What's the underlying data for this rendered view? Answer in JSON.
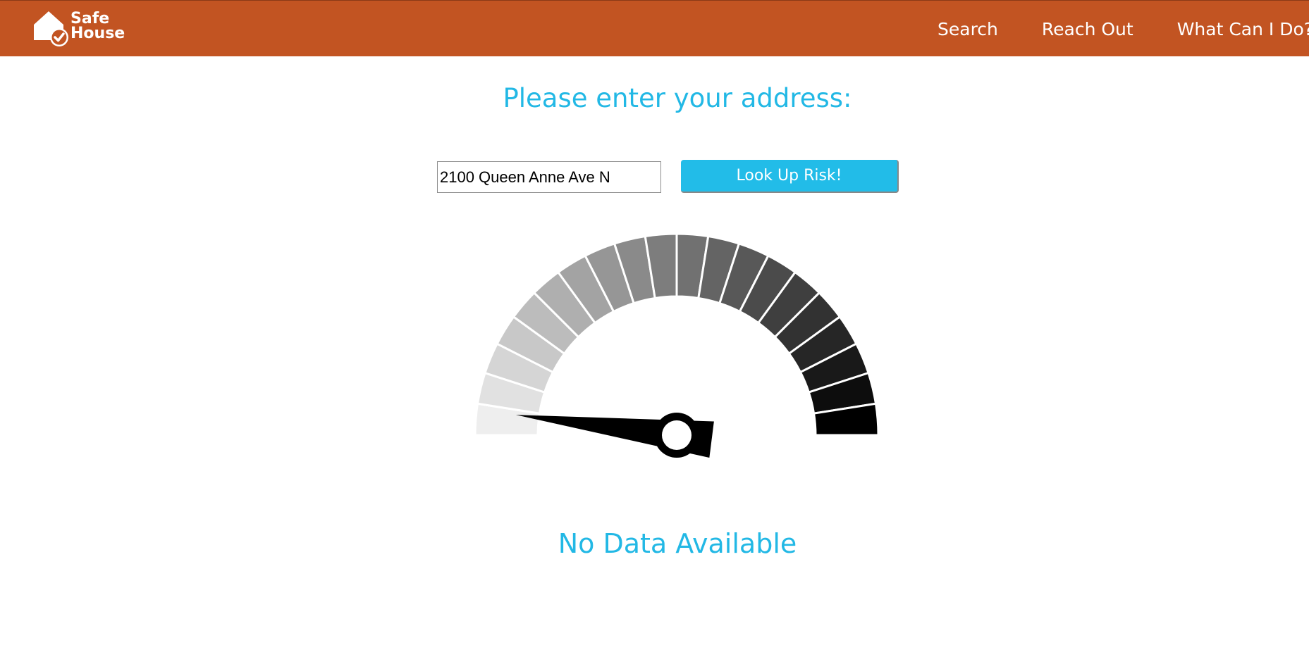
{
  "logo": {
    "line1": "Safe",
    "line2": "House",
    "icon": "house-check-icon"
  },
  "nav": {
    "search_label": "Search",
    "reach_out_label": "Reach Out",
    "what_can_i_do_label": "What Can I Do?"
  },
  "form": {
    "title": "Please enter your address:",
    "address_value": "2100 Queen Anne Ave N",
    "button_label": "Look Up Risk!"
  },
  "gauge": {
    "segment_count": 20,
    "needle_value_fraction": 0.04,
    "low_color": "#eeeeee",
    "high_color": "#000000"
  },
  "status": {
    "text": "No Data Available"
  },
  "colors": {
    "navbar": "#c25422",
    "accent": "#22b8e5",
    "button": "#22bce8"
  }
}
